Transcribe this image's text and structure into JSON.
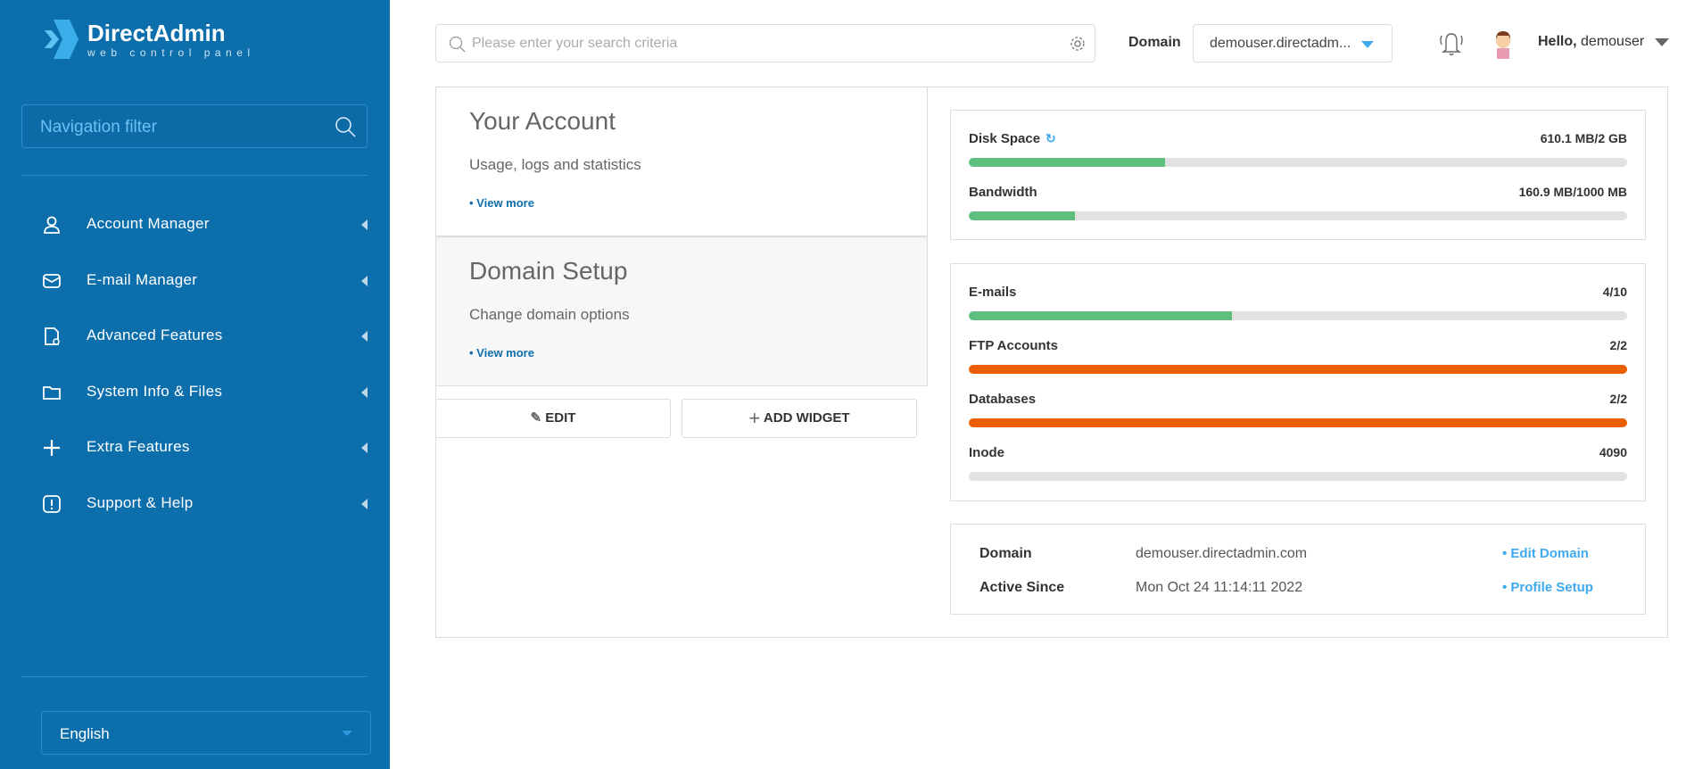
{
  "logo": {
    "title": "DirectAdmin",
    "subtitle": "web control panel"
  },
  "sidebar": {
    "filter_placeholder": "Navigation filter",
    "items": [
      {
        "label": "Account Manager",
        "icon": "user-icon"
      },
      {
        "label": "E-mail Manager",
        "icon": "envelope-icon"
      },
      {
        "label": "Advanced Features",
        "icon": "document-gear-icon"
      },
      {
        "label": "System Info & Files",
        "icon": "folder-icon"
      },
      {
        "label": "Extra Features",
        "icon": "plus-icon"
      },
      {
        "label": "Support & Help",
        "icon": "exclamation-icon"
      }
    ],
    "language": "English"
  },
  "header": {
    "search_placeholder": "Please enter your search criteria",
    "domain_label": "Domain",
    "domain_value": "demouser.directadm...",
    "hello": "Hello,",
    "user": "demouser"
  },
  "cards": [
    {
      "title": "Your Account",
      "subtitle": "Usage, logs and statistics",
      "link": "• View more"
    },
    {
      "title": "Domain Setup",
      "subtitle": "Change domain options",
      "link": "• View more"
    }
  ],
  "buttons": {
    "edit": "EDIT",
    "add_widget": "ADD WIDGET"
  },
  "stats1": [
    {
      "name": "Disk Space",
      "value": "610.1 MB/2 GB",
      "percent": 29.8,
      "color": "#5fbf7f"
    },
    {
      "name": "Bandwidth",
      "value": "160.9 MB/1000 MB",
      "percent": 16.1,
      "color": "#5fbf7f"
    }
  ],
  "stats2": [
    {
      "name": "E-mails",
      "value": "4/10",
      "percent": 40,
      "color": "#5fbf7f"
    },
    {
      "name": "FTP Accounts",
      "value": "2/2",
      "percent": 100,
      "color": "#eb5e00"
    },
    {
      "name": "Databases",
      "value": "2/2",
      "percent": 100,
      "color": "#eb5e00"
    },
    {
      "name": "Inode",
      "value": "4090",
      "percent": 0,
      "color": "#5fbf7f"
    }
  ],
  "info": {
    "domain_label": "Domain",
    "domain_value": "demouser.directadmin.com",
    "active_label": "Active Since",
    "active_value": "Mon Oct 24 11:14:11 2022",
    "edit_domain": "• Edit Domain",
    "profile_setup": "• Profile Setup"
  }
}
